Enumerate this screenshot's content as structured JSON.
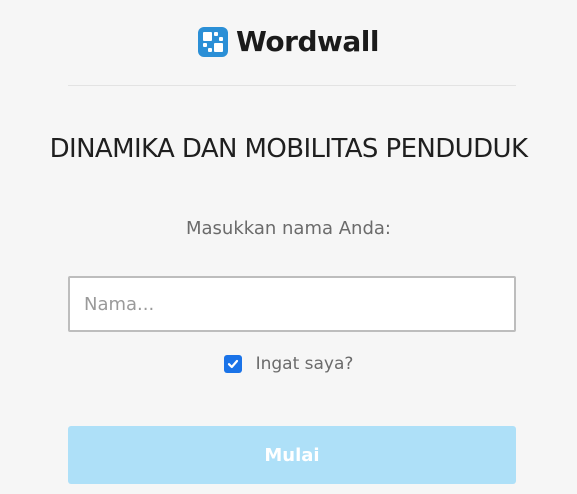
{
  "brand": {
    "name": "Wordwall",
    "logo_icon": "wordwall-logo-icon",
    "accent_color": "#2b8fd6"
  },
  "activity": {
    "title": "DINAMIKA DAN MOBILITAS PENDUDUK"
  },
  "form": {
    "prompt": "Masukkan nama Anda:",
    "name_placeholder": "Nama...",
    "name_value": "",
    "remember_label": "Ingat saya?",
    "remember_checked": true,
    "start_label": "Mulai",
    "start_button_color": "#aee0f8"
  }
}
